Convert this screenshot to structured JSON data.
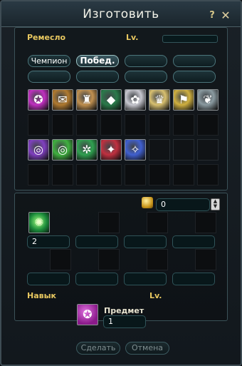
{
  "window": {
    "title": "Изготовить",
    "help": "?",
    "close": "✕"
  },
  "craft": {
    "label": "Ремесло",
    "lv_label": "Lv."
  },
  "filters": [
    {
      "label": "Чемпион",
      "active": false
    },
    {
      "label": "Побед.",
      "active": true
    },
    {
      "label": "",
      "active": false
    },
    {
      "label": "",
      "active": false
    },
    {
      "label": "",
      "active": false
    },
    {
      "label": "",
      "active": false
    },
    {
      "label": "",
      "active": false
    },
    {
      "label": "",
      "active": false
    }
  ],
  "recipes": [
    {
      "icon": "magic-book-icon",
      "glyph": "✪",
      "color": "#c030c0"
    },
    {
      "icon": "scroll-icon",
      "glyph": "✉",
      "color": "#b07a30"
    },
    {
      "icon": "relic-statue-icon",
      "glyph": "♜",
      "color": "#c09050"
    },
    {
      "icon": "green-rune-stone-icon",
      "glyph": "◆",
      "color": "#2a7a4a"
    },
    {
      "icon": "white-orb-icon",
      "glyph": "✿",
      "color": "#c8c8d0"
    },
    {
      "icon": "crown-icon",
      "glyph": "♛",
      "color": "#d8c070"
    },
    {
      "icon": "golden-banner-icon",
      "glyph": "⚑",
      "color": "#d0b040"
    },
    {
      "icon": "silver-charm-icon",
      "glyph": "❦",
      "color": "#8a9aa0"
    },
    {
      "icon": "purple-orb-icon",
      "glyph": "◎",
      "color": "#8040c0"
    },
    {
      "icon": "green-orb-icon",
      "glyph": "◎",
      "color": "#40b040"
    },
    {
      "icon": "green-rune-orb-icon",
      "glyph": "✲",
      "color": "#30a050"
    },
    {
      "icon": "red-orb-icon",
      "glyph": "✦",
      "color": "#c03040"
    },
    {
      "icon": "blue-orb-icon",
      "glyph": "✧",
      "color": "#4060d0"
    }
  ],
  "cost": {
    "value": "0",
    "icon": "gold-coin-icon"
  },
  "materials": [
    {
      "icon": "green-crystal-icon",
      "glyph": "✺",
      "color": "#1a8a3a",
      "quantity": "2"
    }
  ],
  "skill": {
    "label": "Навык",
    "lv_label": "Lv."
  },
  "result": {
    "label": "Предмет",
    "quantity": "1",
    "icon": "magic-book-icon",
    "glyph": "✪",
    "color": "#c030c0"
  },
  "footer": {
    "make": "Сделать",
    "cancel": "Отмена"
  }
}
